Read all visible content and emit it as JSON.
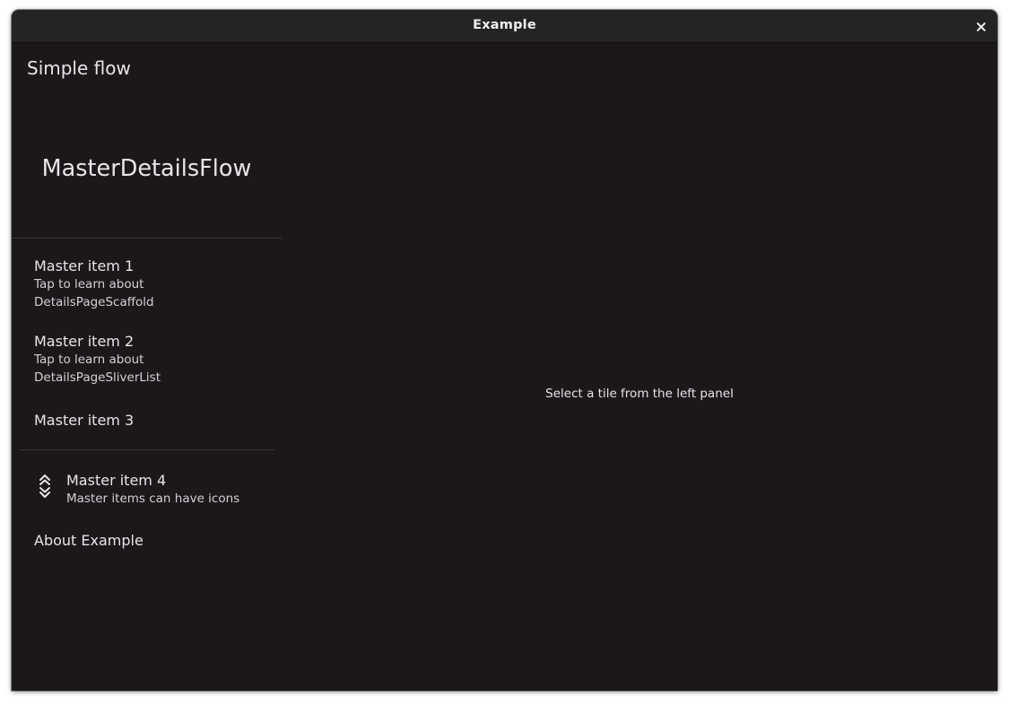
{
  "window": {
    "title": "Example"
  },
  "app": {
    "title": "Simple flow"
  },
  "drawer": {
    "header_title": "MasterDetailsFlow",
    "items": [
      {
        "title": "Master item 1",
        "subtitle_line1": "Tap to learn about",
        "subtitle_line2": "DetailsPageScaffold"
      },
      {
        "title": "Master item 2",
        "subtitle_line1": "Tap to learn about",
        "subtitle_line2": "DetailsPageSliverList"
      },
      {
        "title": "Master item 3"
      },
      {
        "title": "Master item 4",
        "subtitle": "Master items can have icons",
        "icon": "double-chevron-up-down-icon"
      },
      {
        "title": "About Example"
      }
    ]
  },
  "details": {
    "placeholder": "Select a tile from the left panel"
  },
  "colors": {
    "background": "#1b171b",
    "titlebar": "#262326",
    "text": "#e8e4e8",
    "divider": "#3a363a"
  }
}
